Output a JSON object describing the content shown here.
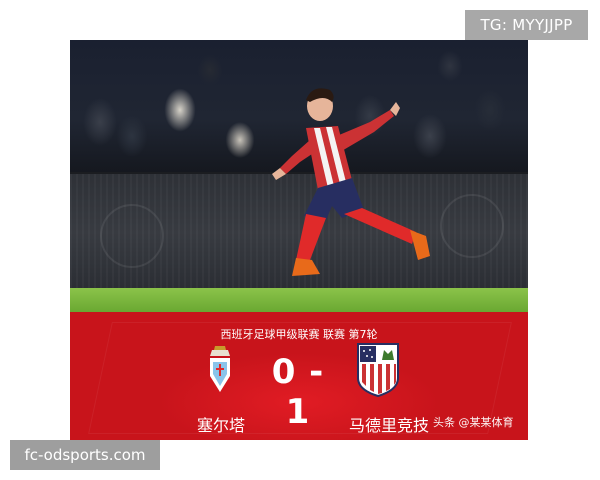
{
  "watermarks": {
    "top_right": "TG: MYYJJPP",
    "bottom_left": "fc-odsports.com",
    "overlay": "头条 @某某体育"
  },
  "match": {
    "league_title": "西班牙足球甲级联赛 联赛 第7轮",
    "score": "0 - 1",
    "home_team": "塞尔塔",
    "away_team": "马德里竞技"
  },
  "colors": {
    "panel_red": "#c8141b",
    "pitch_green": "#7cba3e",
    "atleti_red": "#cb3234",
    "atleti_blue": "#272e61"
  },
  "icons": {
    "home_crest": "celta-vigo-crest-icon",
    "away_crest": "atletico-madrid-crest-icon"
  }
}
